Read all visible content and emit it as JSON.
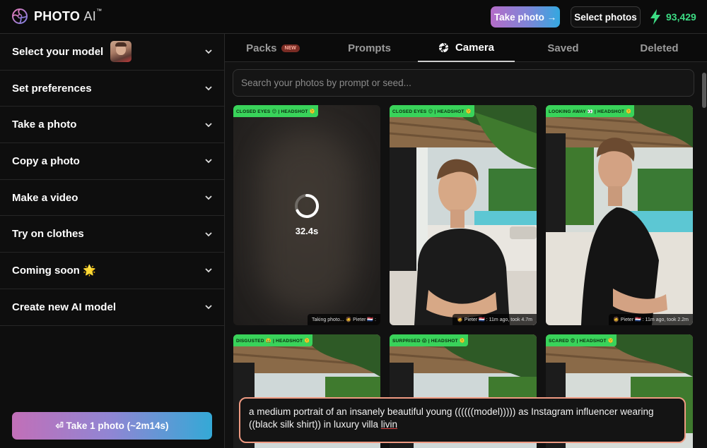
{
  "header": {
    "logo_word": "PHOTO",
    "logo_ai": "AI",
    "logo_tm": "™",
    "take_photo_label": "Take photo →",
    "select_photos_label": "Select photos",
    "credits": "93,429",
    "credits_color": "#3ddc84"
  },
  "sidebar": {
    "items": [
      {
        "label": "Select your model"
      },
      {
        "label": "Set preferences"
      },
      {
        "label": "Take a photo"
      },
      {
        "label": "Copy a photo"
      },
      {
        "label": "Make a video"
      },
      {
        "label": "Try on clothes"
      },
      {
        "label": "Coming soon 🌟"
      },
      {
        "label": "Create new AI model"
      }
    ],
    "cta_label": "⏎ Take 1 photo (~2m14s)"
  },
  "tabs": [
    {
      "label": "Packs",
      "badge": "NEW"
    },
    {
      "label": "Prompts"
    },
    {
      "label": "Camera",
      "active": true,
      "icon": "aperture-icon"
    },
    {
      "label": "Saved"
    },
    {
      "label": "Deleted"
    }
  ],
  "search": {
    "placeholder": "Search your photos by prompt or seed..."
  },
  "cards": [
    {
      "tag": "CLOSED EYES 😌 | HEADSHOT 🫠",
      "meta": "Taking photo... 🧔 Pieter 🇳🇱 :",
      "timer": "32.4s",
      "status": "generating"
    },
    {
      "tag": "CLOSED EYES 😌 | HEADSHOT 🫠",
      "meta": "🧔 Pieter 🇳🇱 : 11m ago, took 4.7m"
    },
    {
      "tag": "LOOKING AWAY 👀 | HEADSHOT 🫠",
      "meta": "🧔 Pieter 🇳🇱 : 11m ago, took 2.2m"
    },
    {
      "tag": "DISGUSTED 🤮 | HEADSHOT 🫠"
    },
    {
      "tag": "SURPRISED 😱 | HEADSHOT 🫠"
    },
    {
      "tag": "SCARED 😨 | HEADSHOT 🫠"
    }
  ],
  "prompt": {
    "text_main": "a medium portrait of an insanely beautiful young ((((((model))))) as Instagram influencer wearing ((black silk shirt)) in luxury villa ",
    "text_underlined": "livin"
  }
}
